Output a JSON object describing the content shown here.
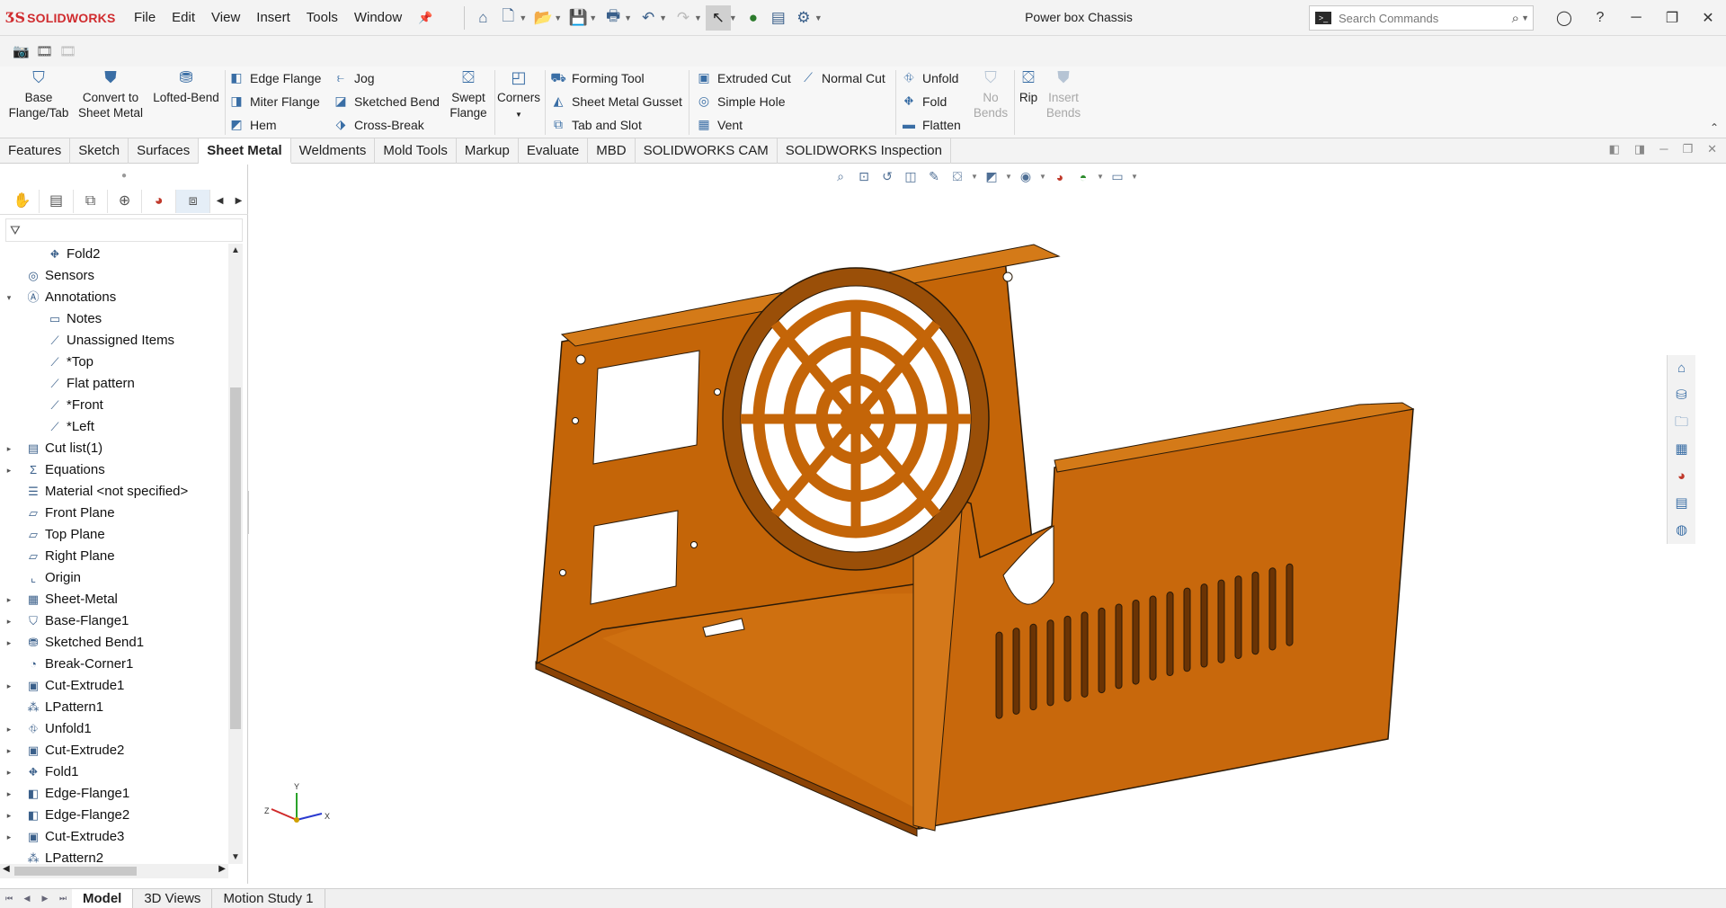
{
  "app": {
    "brand": "SOLIDWORKS",
    "document_title": "Power box Chassis",
    "menus": [
      "File",
      "Edit",
      "View",
      "Insert",
      "Tools",
      "Window"
    ]
  },
  "search": {
    "placeholder": "Search Commands"
  },
  "ribbon": {
    "base_flange": "Base\nFlange/Tab",
    "convert": "Convert to\nSheet Metal",
    "lofted_bend": "Lofted-Bend",
    "edge_flange": "Edge Flange",
    "miter_flange": "Miter Flange",
    "hem": "Hem",
    "jog": "Jog",
    "sketched_bend": "Sketched Bend",
    "cross_break": "Cross-Break",
    "swept_flange": "Swept\nFlange",
    "corners": "Corners",
    "forming_tool": "Forming Tool",
    "gusset": "Sheet Metal Gusset",
    "tab_slot": "Tab and Slot",
    "extruded_cut": "Extruded Cut",
    "simple_hole": "Simple Hole",
    "vent": "Vent",
    "normal_cut": "Normal Cut",
    "unfold": "Unfold",
    "fold": "Fold",
    "flatten": "Flatten",
    "no_bends": "No\nBends",
    "rip": "Rip",
    "insert_bends": "Insert\nBends"
  },
  "tabs": [
    {
      "label": "Features",
      "active": false
    },
    {
      "label": "Sketch",
      "active": false
    },
    {
      "label": "Surfaces",
      "active": false
    },
    {
      "label": "Sheet Metal",
      "active": true
    },
    {
      "label": "Weldments",
      "active": false
    },
    {
      "label": "Mold Tools",
      "active": false
    },
    {
      "label": "Markup",
      "active": false
    },
    {
      "label": "Evaluate",
      "active": false
    },
    {
      "label": "MBD",
      "active": false
    },
    {
      "label": "SOLIDWORKS CAM",
      "active": false
    },
    {
      "label": "SOLIDWORKS Inspection",
      "active": false
    }
  ],
  "tree": [
    {
      "label": "Fold2",
      "level": 2,
      "expand": false,
      "icon": "fold-icon"
    },
    {
      "label": "Sensors",
      "level": 1,
      "expand": false,
      "icon": "sensor-icon"
    },
    {
      "label": "Annotations",
      "level": 1,
      "expand": "open",
      "icon": "annotation-icon"
    },
    {
      "label": "Notes",
      "level": 2,
      "expand": false,
      "icon": "notes-icon"
    },
    {
      "label": "Unassigned Items",
      "level": 2,
      "expand": false,
      "icon": "view-icon"
    },
    {
      "label": "*Top",
      "level": 2,
      "expand": false,
      "icon": "view-icon"
    },
    {
      "label": "Flat pattern",
      "level": 2,
      "expand": false,
      "icon": "view-icon"
    },
    {
      "label": "*Front",
      "level": 2,
      "expand": false,
      "icon": "view-icon"
    },
    {
      "label": "*Left",
      "level": 2,
      "expand": false,
      "icon": "view-icon"
    },
    {
      "label": "Cut list(1)",
      "level": 1,
      "expand": "closed",
      "icon": "cutlist-icon"
    },
    {
      "label": "Equations",
      "level": 1,
      "expand": "closed",
      "icon": "equations-icon"
    },
    {
      "label": "Material <not specified>",
      "level": 1,
      "expand": false,
      "icon": "material-icon"
    },
    {
      "label": "Front Plane",
      "level": 1,
      "expand": false,
      "icon": "plane-icon"
    },
    {
      "label": "Top Plane",
      "level": 1,
      "expand": false,
      "icon": "plane-icon"
    },
    {
      "label": "Right Plane",
      "level": 1,
      "expand": false,
      "icon": "plane-icon"
    },
    {
      "label": "Origin",
      "level": 1,
      "expand": false,
      "icon": "origin-icon"
    },
    {
      "label": "Sheet-Metal",
      "level": 1,
      "expand": "closed",
      "icon": "sheetmetal-icon"
    },
    {
      "label": "Base-Flange1",
      "level": 1,
      "expand": "closed",
      "icon": "flange-icon"
    },
    {
      "label": "Sketched Bend1",
      "level": 1,
      "expand": "closed",
      "icon": "bend-icon"
    },
    {
      "label": "Break-Corner1",
      "level": 1,
      "expand": false,
      "icon": "corner-icon"
    },
    {
      "label": "Cut-Extrude1",
      "level": 1,
      "expand": "closed",
      "icon": "cut-icon"
    },
    {
      "label": "LPattern1",
      "level": 1,
      "expand": false,
      "icon": "pattern-icon"
    },
    {
      "label": "Unfold1",
      "level": 1,
      "expand": "closed",
      "icon": "unfold-icon"
    },
    {
      "label": "Cut-Extrude2",
      "level": 1,
      "expand": "closed",
      "icon": "cut-icon"
    },
    {
      "label": "Fold1",
      "level": 1,
      "expand": "closed",
      "icon": "fold-icon"
    },
    {
      "label": "Edge-Flange1",
      "level": 1,
      "expand": "closed",
      "icon": "edge-flange-icon"
    },
    {
      "label": "Edge-Flange2",
      "level": 1,
      "expand": "closed",
      "icon": "edge-flange-icon"
    },
    {
      "label": "Cut-Extrude3",
      "level": 1,
      "expand": "closed",
      "icon": "cut-icon"
    },
    {
      "label": "LPattern2",
      "level": 1,
      "expand": false,
      "icon": "pattern-icon"
    }
  ],
  "bottom_tabs": [
    {
      "label": "Model",
      "active": true
    },
    {
      "label": "3D Views",
      "active": false
    },
    {
      "label": "Motion Study 1",
      "active": false
    }
  ],
  "triad": {
    "x": "X",
    "y": "Y",
    "z": "Z"
  },
  "colors": {
    "part": "#c8680c",
    "part_dark": "#8a4306",
    "part_light": "#e08a2a",
    "edge": "#2a1a08",
    "brand": "#d02c2f"
  }
}
